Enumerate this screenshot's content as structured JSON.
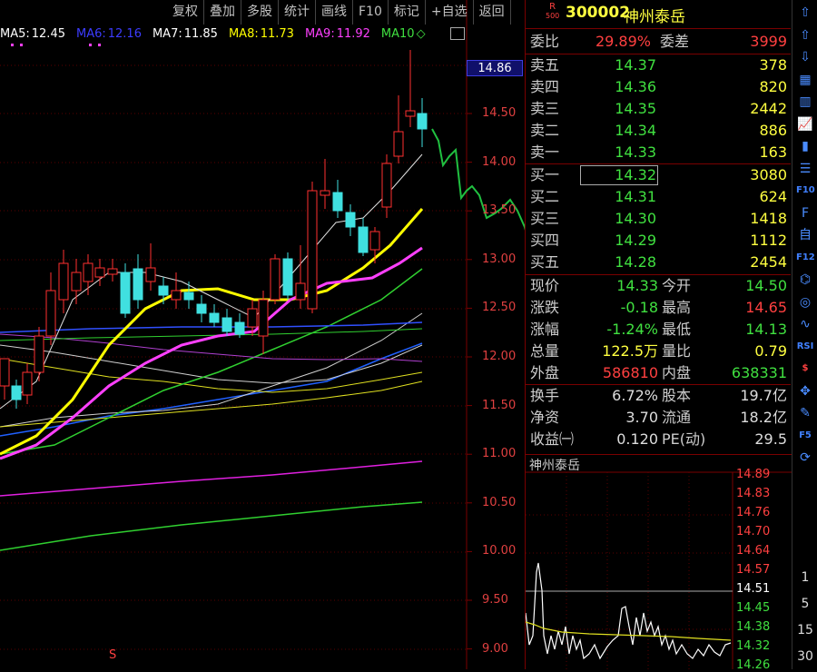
{
  "toolbar": {
    "items": [
      "复权",
      "叠加",
      "多股",
      "统计",
      "画线",
      "F10",
      "标记",
      "+自选",
      "返回"
    ]
  },
  "ma_legend": [
    {
      "label": "MA5:",
      "value": "12.45",
      "color": "#ffffff"
    },
    {
      "label": "MA6:",
      "value": "12.16",
      "color": "#3c3cff"
    },
    {
      "label": "MA7:",
      "value": "11.85",
      "color": "#ffffff"
    },
    {
      "label": "MA8:",
      "value": "11.73",
      "color": "#ffff00"
    },
    {
      "label": "MA9:",
      "value": "11.92",
      "color": "#ff40ff"
    },
    {
      "label": "MA10",
      "value": "◇",
      "color": "#40e040"
    }
  ],
  "y_axis": {
    "current_price": "14.86",
    "ticks": [
      "14.50",
      "14.00",
      "13.50",
      "13.00",
      "12.50",
      "12.00",
      "11.50",
      "11.00",
      "10.50",
      "10.00",
      "9.50",
      "9.00"
    ]
  },
  "bottom_marker": "S",
  "header": {
    "badge_top": "R",
    "badge_bottom": "500",
    "code": "300002",
    "name": "神州泰岳"
  },
  "order": {
    "weibi_label": "委比",
    "weibi_value": "29.89%",
    "weicha_label": "委差",
    "weicha_value": "3999"
  },
  "sell": [
    {
      "label": "卖五",
      "price": "14.37",
      "vol": "378"
    },
    {
      "label": "卖四",
      "price": "14.36",
      "vol": "820"
    },
    {
      "label": "卖三",
      "price": "14.35",
      "vol": "2442"
    },
    {
      "label": "卖二",
      "price": "14.34",
      "vol": "886"
    },
    {
      "label": "卖一",
      "price": "14.33",
      "vol": "163"
    }
  ],
  "buy": [
    {
      "label": "买一",
      "price": "14.32",
      "vol": "3080"
    },
    {
      "label": "买二",
      "price": "14.31",
      "vol": "624"
    },
    {
      "label": "买三",
      "price": "14.30",
      "vol": "1418"
    },
    {
      "label": "买四",
      "price": "14.29",
      "vol": "1112"
    },
    {
      "label": "买五",
      "price": "14.28",
      "vol": "2454"
    }
  ],
  "stats": [
    {
      "l1": "现价",
      "v1": "14.33",
      "c1": "#40e040",
      "l2": "今开",
      "v2": "14.50",
      "c2": "#40e040"
    },
    {
      "l1": "涨跌",
      "v1": "-0.18",
      "c1": "#40e040",
      "l2": "最高",
      "v2": "14.65",
      "c2": "#ff4040"
    },
    {
      "l1": "涨幅",
      "v1": "-1.24%",
      "c1": "#40e040",
      "l2": "最低",
      "v2": "14.13",
      "c2": "#40e040"
    },
    {
      "l1": "总量",
      "v1": "122.5万",
      "c1": "#ffff40",
      "l2": "量比",
      "v2": "0.79",
      "c2": "#ffff40"
    },
    {
      "l1": "外盘",
      "v1": "586810",
      "c1": "#ff4040",
      "l2": "内盘",
      "v2": "638331",
      "c2": "#40e040"
    }
  ],
  "stats2": [
    {
      "l1": "换手",
      "v1": "6.72%",
      "l2": "股本",
      "v2": "19.7亿"
    },
    {
      "l1": "净资",
      "v1": "3.70",
      "l2": "流通",
      "v2": "18.2亿"
    },
    {
      "l1": "收益㈠",
      "v1": "0.120",
      "l2": "PE(动)",
      "v2": "29.5"
    }
  ],
  "mini": {
    "title": "神州泰岳",
    "ticks": [
      {
        "v": "14.89",
        "c": "#ff4040"
      },
      {
        "v": "14.83",
        "c": "#ff4040"
      },
      {
        "v": "14.76",
        "c": "#ff4040"
      },
      {
        "v": "14.70",
        "c": "#ff4040"
      },
      {
        "v": "14.64",
        "c": "#ff4040"
      },
      {
        "v": "14.57",
        "c": "#ff4040"
      },
      {
        "v": "14.51",
        "c": "#ffffff"
      },
      {
        "v": "14.45",
        "c": "#40e040"
      },
      {
        "v": "14.38",
        "c": "#40e040"
      },
      {
        "v": "14.32",
        "c": "#40e040"
      },
      {
        "v": "14.26",
        "c": "#40e040"
      }
    ]
  },
  "side_toolbar": [
    "up-arrow-icon",
    "up-outline-icon",
    "down-outline-icon",
    "grid-icon",
    "table-icon",
    "line-chart-icon",
    "candle-icon",
    "list-icon",
    "f10-icon",
    "f-icon",
    "self-icon",
    "f2-icon",
    "chart-icon",
    "circle-icon",
    "wave-icon",
    "rsi-icon",
    "s-icon",
    "move-icon",
    "pen-icon",
    "f5-icon",
    "refresh-icon"
  ],
  "side_numbers": [
    "1",
    "5",
    "15",
    "30"
  ],
  "side_labels": {
    "rsi": "RSI",
    "s": "$",
    "f10": "F10",
    "f2": "F12",
    "f5": "F5"
  },
  "colors": {
    "up": "#ff3030",
    "down": "#40e0e0",
    "axis": "#7a0000"
  }
}
